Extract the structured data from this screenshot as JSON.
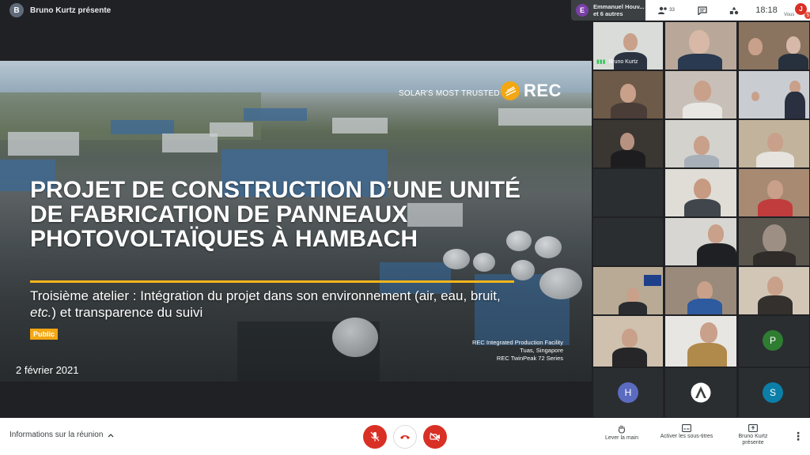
{
  "top_bar": {
    "presenter_avatar": "B",
    "presenter_text": "Bruno Kurtz présente",
    "participants_avatar": "E",
    "participants_line1": "Emmanuel Houv...",
    "participants_line2": "et 6 autres",
    "people_count": "33",
    "clock": "18:18",
    "you_label": "Vous",
    "you_avatar": "J",
    "notification_count": "5"
  },
  "slide": {
    "tagline": "SOLAR'S MOST TRUSTED",
    "logo_text": "REC",
    "title": "PROJET DE CONSTRUCTION D’UNE UNITÉ DE FABRICATION DE PANNEAUX PHOTOVOLTAÏQUES À HAMBACH",
    "subtitle_part1": "Troisième atelier : Intégration du projet dans son environnement (air, eau, bruit, ",
    "subtitle_em": "etc.",
    "subtitle_part2": ") et transparence du suivi",
    "badge": "Public",
    "date": "2 février 2021",
    "caption_line1": "REC Integrated Production Facility",
    "caption_line2": "Tuas, Singapore",
    "caption_line3": "REC TwinPeak 72 Series",
    "brand_color": "#f3a712"
  },
  "grid": {
    "active_speaker_name": "Bruno Kurtz",
    "avatar_p": "P",
    "avatar_h": "H",
    "avatar_s": "S",
    "avatar_h_color": "#5b6bc0",
    "avatar_p_color": "#2e7d32",
    "avatar_s_color": "#0b7fa8"
  },
  "bottom_bar": {
    "meeting_info": "Informations sur la réunion",
    "raise_hand": "Lever la main",
    "captions": "Activer les sous-titres",
    "presenting_line1": "Bruno Kurtz",
    "presenting_line2": "présente"
  }
}
